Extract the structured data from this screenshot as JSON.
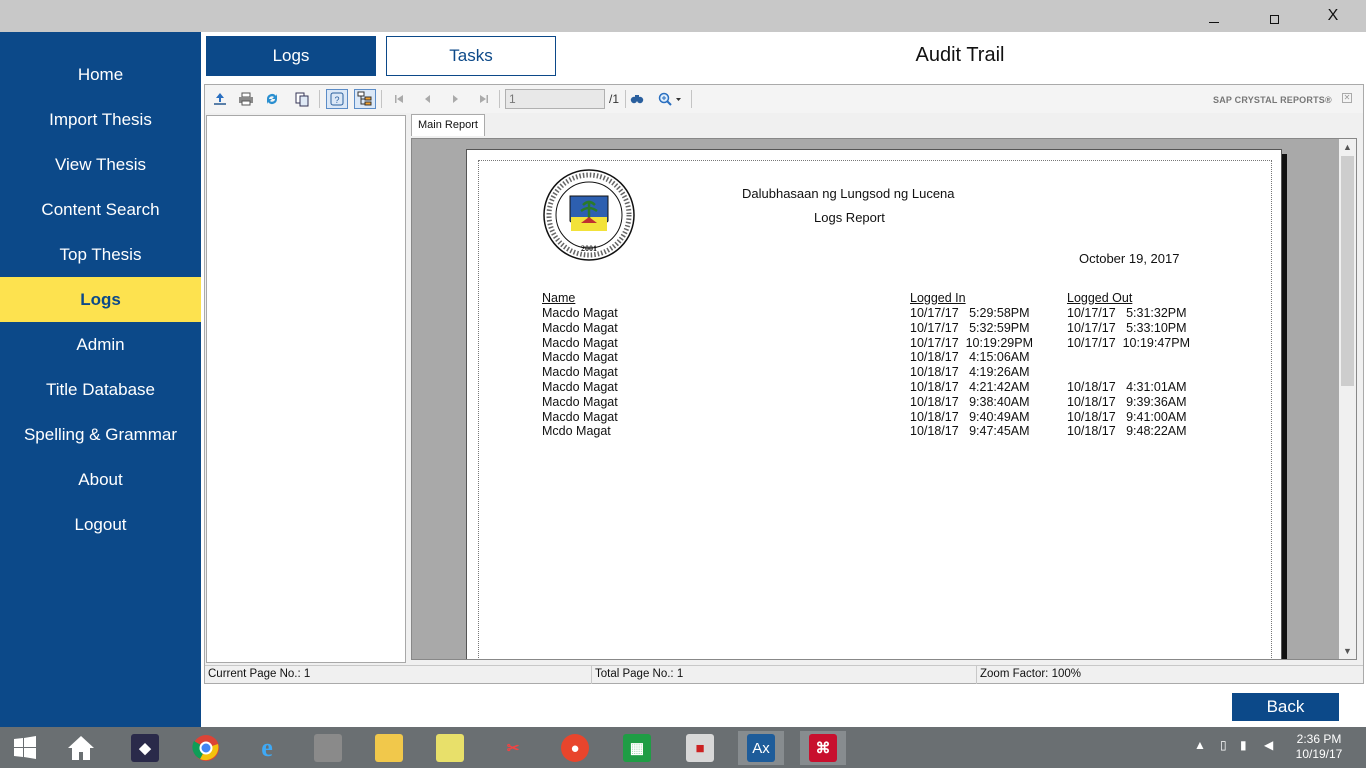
{
  "window": {
    "minimize": "",
    "maximize": "",
    "close": "X"
  },
  "sidebar": {
    "items": [
      {
        "label": "Home"
      },
      {
        "label": "Import Thesis"
      },
      {
        "label": "View Thesis"
      },
      {
        "label": "Content Search"
      },
      {
        "label": "Top Thesis"
      },
      {
        "label": "Logs",
        "active": true
      },
      {
        "label": "Admin"
      },
      {
        "label": "Title Database"
      },
      {
        "label": "Spelling & Grammar"
      },
      {
        "label": "About"
      },
      {
        "label": "Logout"
      }
    ]
  },
  "tabs": {
    "logs": "Logs",
    "tasks": "Tasks"
  },
  "page_title": "Audit Trail",
  "viewer": {
    "toolbar": {
      "icons": [
        "export-icon",
        "print-icon",
        "refresh-icon",
        "copy-icon",
        "help-icon",
        "group-tree-icon",
        "first-page-icon",
        "prev-page-icon",
        "next-page-icon",
        "last-page-icon",
        "find-icon",
        "zoom-icon"
      ],
      "page_value": "1",
      "page_total": "/1",
      "brand": "SAP CRYSTAL REPORTS®"
    },
    "report_tab": "Main Report",
    "report": {
      "school": "Dalubhasaan ng Lungsod ng Lucena",
      "title": "Logs Report",
      "date": "October 19, 2017",
      "seal_year": "2001",
      "columns": {
        "name": "Name",
        "logged_in": "Logged In",
        "logged_out": "Logged Out"
      },
      "rows": [
        {
          "name": "Macdo Magat",
          "in": "10/17/17   5:29:58PM",
          "out": "10/17/17   5:31:32PM"
        },
        {
          "name": "Macdo Magat",
          "in": "10/17/17   5:32:59PM",
          "out": "10/17/17   5:33:10PM"
        },
        {
          "name": "Macdo Magat",
          "in": "10/17/17  10:19:29PM",
          "out": "10/17/17  10:19:47PM"
        },
        {
          "name": "Macdo Magat",
          "in": "10/18/17   4:15:06AM",
          "out": ""
        },
        {
          "name": "Macdo Magat",
          "in": "10/18/17   4:19:26AM",
          "out": ""
        },
        {
          "name": "Macdo Magat",
          "in": "10/18/17   4:21:42AM",
          "out": "10/18/17   4:31:01AM"
        },
        {
          "name": "Macdo Magat",
          "in": "10/18/17   9:38:40AM",
          "out": "10/18/17   9:39:36AM"
        },
        {
          "name": "Macdo Magat",
          "in": "10/18/17   9:40:49AM",
          "out": "10/18/17   9:41:00AM"
        },
        {
          "name": "Mcdo Magat",
          "in": "10/18/17   9:47:45AM",
          "out": "10/18/17   9:48:22AM"
        }
      ]
    },
    "status": {
      "current_page": "Current Page No.: 1",
      "total_page": "Total Page No.: 1",
      "zoom": "Zoom Factor: 100%"
    }
  },
  "back_button": "Back",
  "taskbar": {
    "apps": [
      "windows-start-icon",
      "home-icon",
      "anime-avatar-icon",
      "chrome-icon",
      "internet-explorer-icon",
      "wall-icon",
      "file-explorer-icon",
      "sticky-notes-icon",
      "snipping-tool-icon",
      "camera-app-icon",
      "excel-icon",
      "media-icon",
      "ax-app-icon",
      "acrobat-icon"
    ],
    "ax_label": "Ax",
    "clock_time": "2:36 PM",
    "clock_date": "10/19/17"
  },
  "colors": {
    "sidebar_bg": "#0c4989",
    "active_nav": "#fde24f",
    "accent": "#0c4989"
  }
}
